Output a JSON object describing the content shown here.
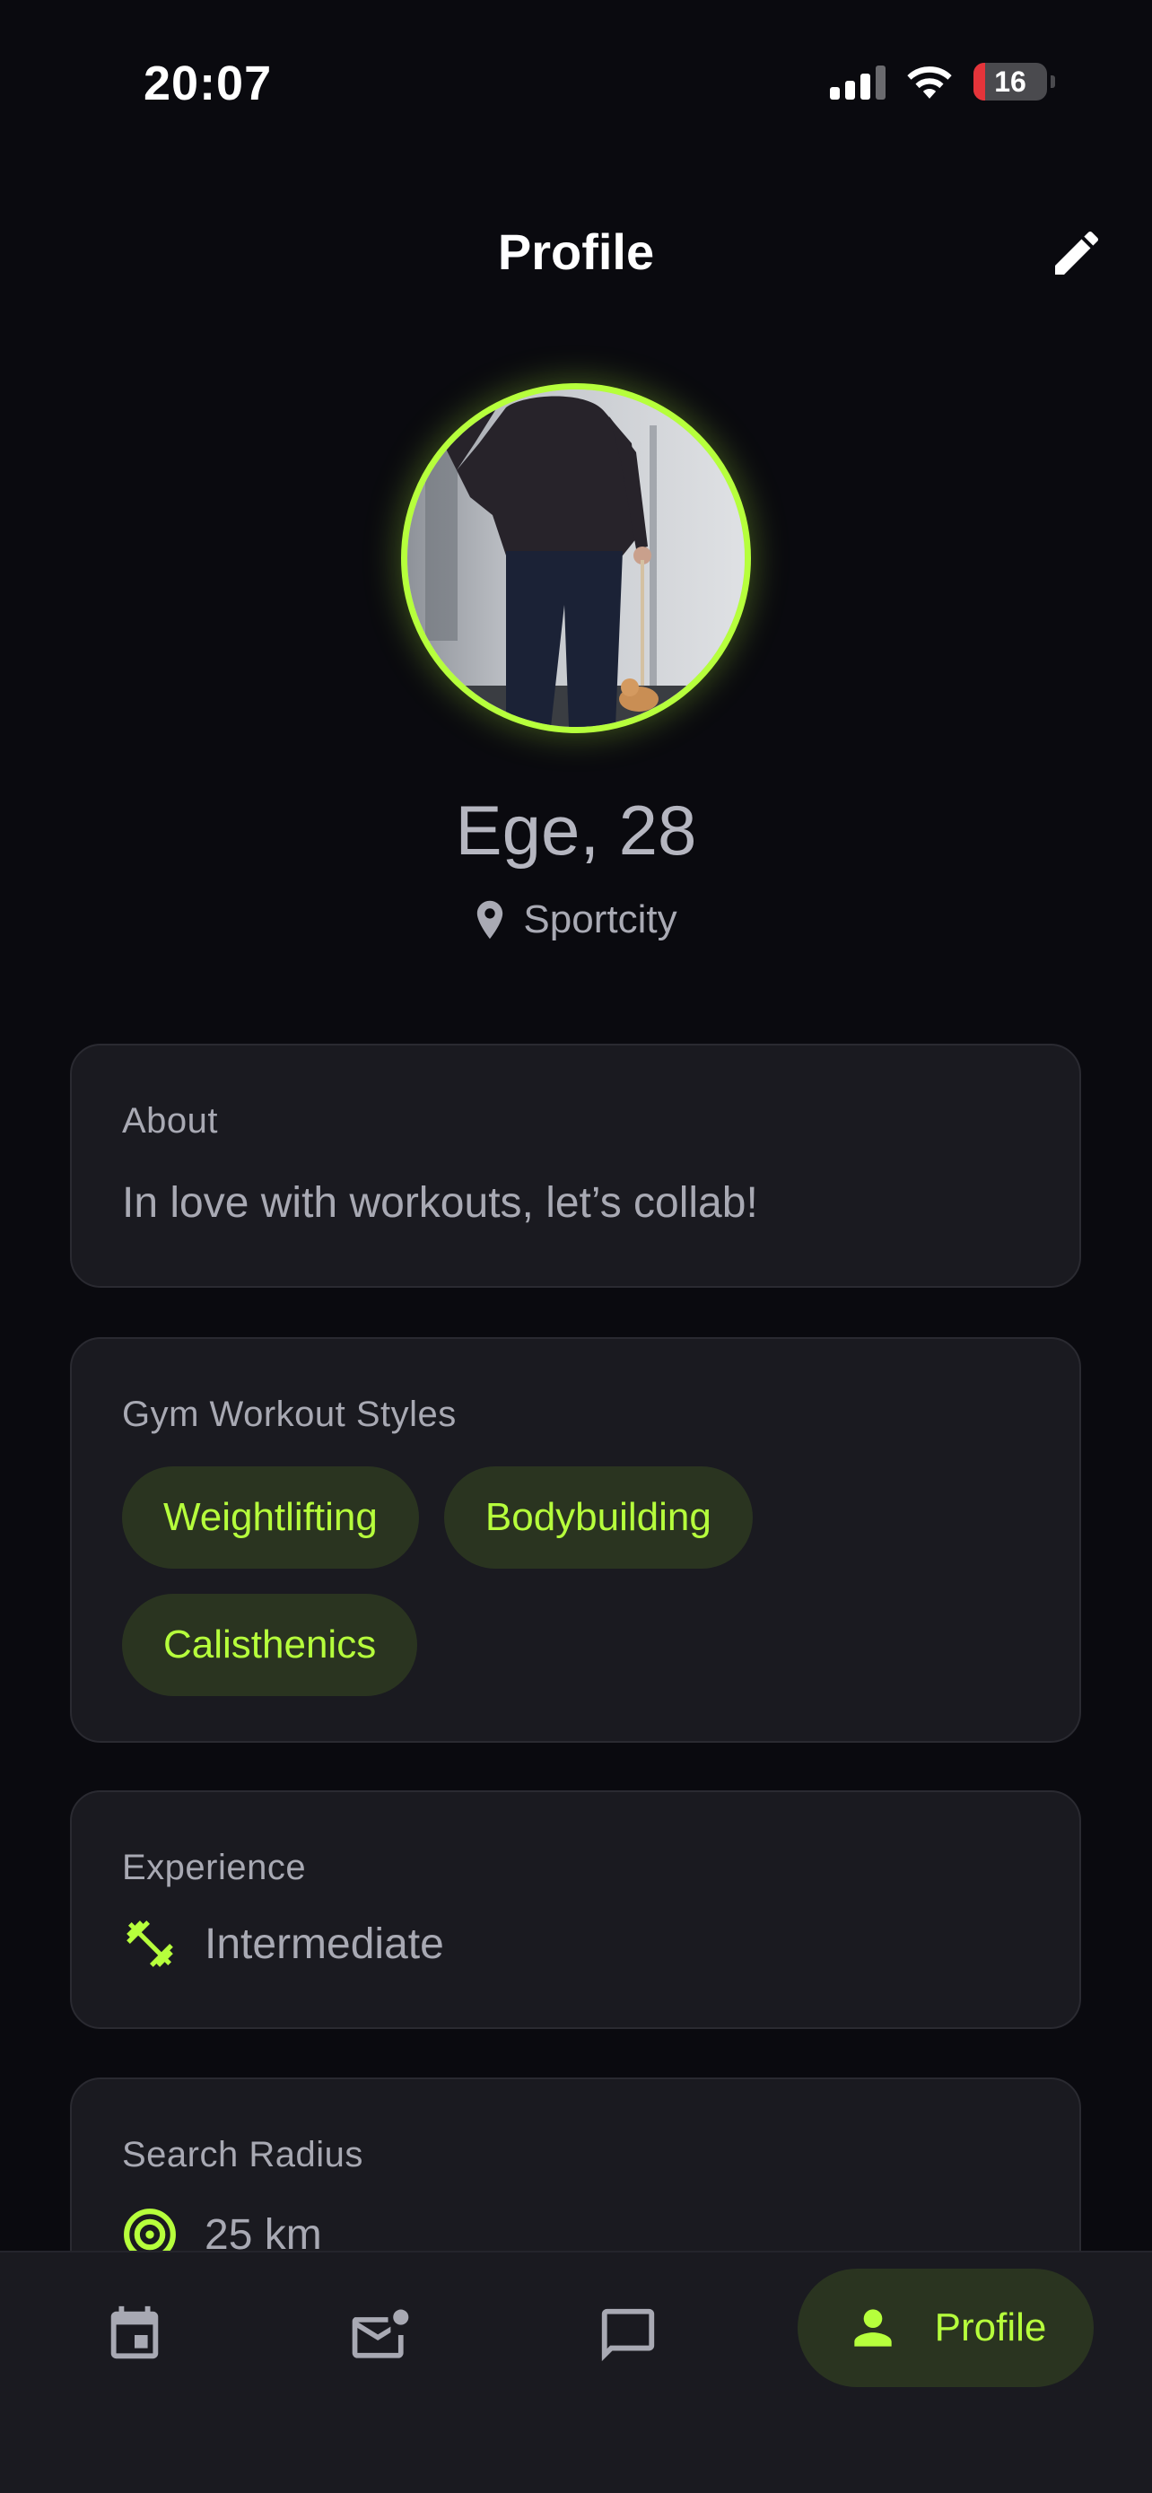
{
  "status_bar": {
    "time": "20:07",
    "battery": "16",
    "battery_level": 0.16
  },
  "header": {
    "title": "Profile"
  },
  "profile": {
    "name_age": "Ege, 28",
    "location": "Sportcity"
  },
  "about": {
    "title": "About",
    "text": "In love with workouts, let’s collab!"
  },
  "workout_styles": {
    "title": "Gym Workout Styles",
    "chips": [
      "Weightlifting",
      "Bodybuilding",
      "Calisthenics"
    ]
  },
  "experience": {
    "title": "Experience",
    "value": "Intermediate",
    "icon": "dumbbell-icon"
  },
  "search_radius": {
    "title": "Search Radius",
    "value": "25 km",
    "icon": "radius-target-icon"
  },
  "bottom_nav": {
    "items": [
      {
        "icon": "calendar-icon"
      },
      {
        "icon": "mail-notification-icon"
      },
      {
        "icon": "chat-icon"
      },
      {
        "icon": "person-icon",
        "label": "Profile",
        "active": true
      }
    ]
  },
  "colors": {
    "accent": "#b6ff3c",
    "background": "#0a0a0f",
    "card": "#1a1a20",
    "chip_bg": "#2a3420",
    "muted_text": "#a8a9b3"
  }
}
